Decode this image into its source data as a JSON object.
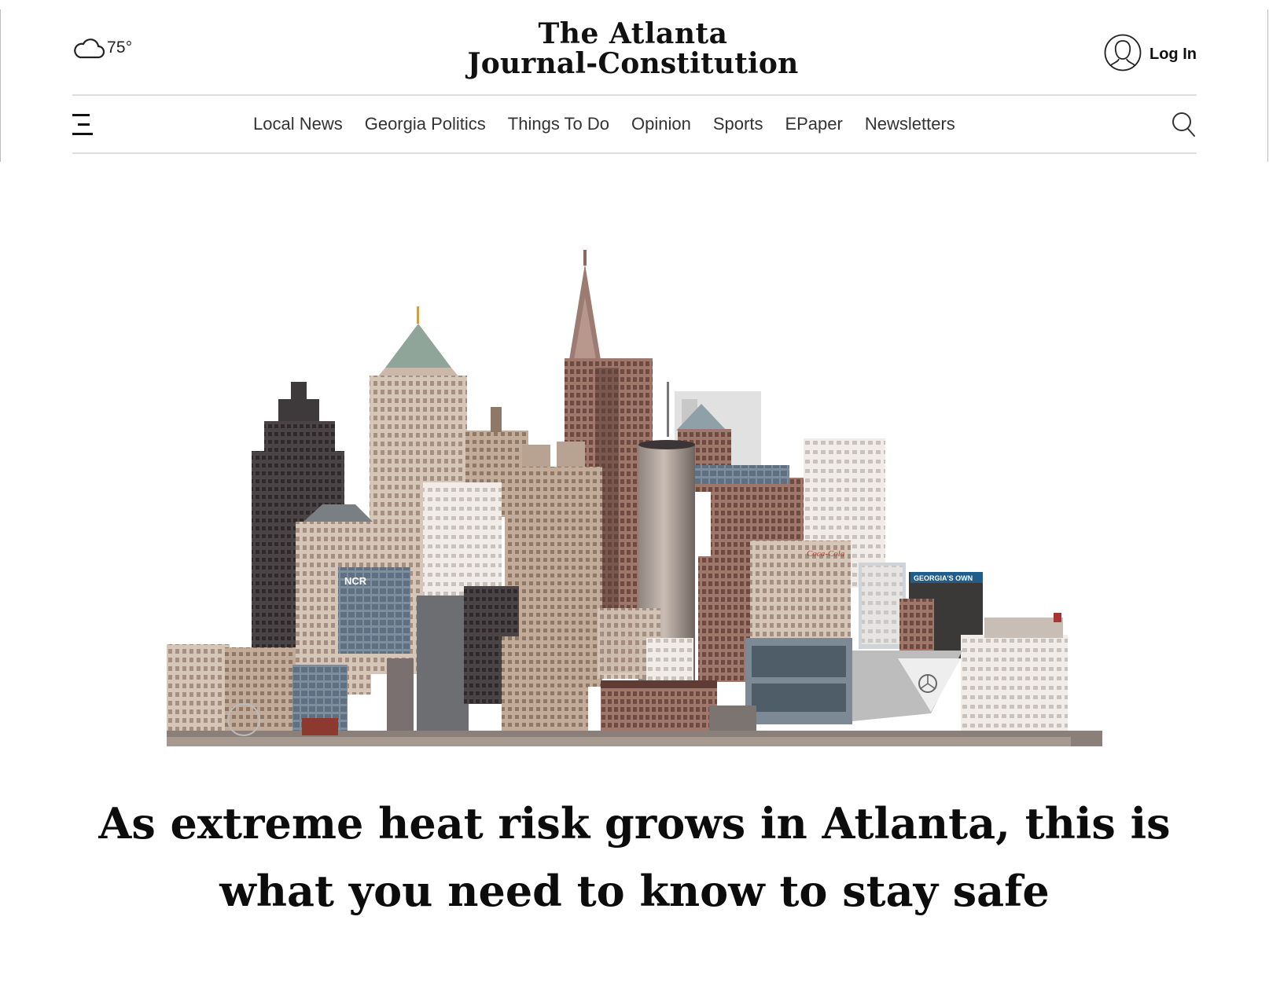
{
  "weather": {
    "icon": "cloud-icon",
    "temperature": "75°"
  },
  "masthead": {
    "line1": "The Atlanta",
    "line2": "Journal-Constitution"
  },
  "account": {
    "icon": "user-icon",
    "login_label": "Log In"
  },
  "nav": {
    "menu_icon": "hamburger-menu-icon",
    "items": [
      {
        "label": "Local News"
      },
      {
        "label": "Georgia Politics"
      },
      {
        "label": "Things To Do"
      },
      {
        "label": "Opinion"
      },
      {
        "label": "Sports"
      },
      {
        "label": "EPaper"
      },
      {
        "label": "Newsletters"
      }
    ],
    "search_icon": "search-icon"
  },
  "hero": {
    "image": "atlanta-skyline-illustration",
    "signs": {
      "ncr": "NCR",
      "georgias_own": "GEORGIA'S OWN",
      "coca_cola": "Coca-Cola"
    }
  },
  "article": {
    "headline": "As extreme heat risk grows in Atlanta, this is what you need to know to stay safe"
  },
  "colors": {
    "text": "#111111",
    "divider": "#dedede",
    "background": "#ffffff"
  }
}
